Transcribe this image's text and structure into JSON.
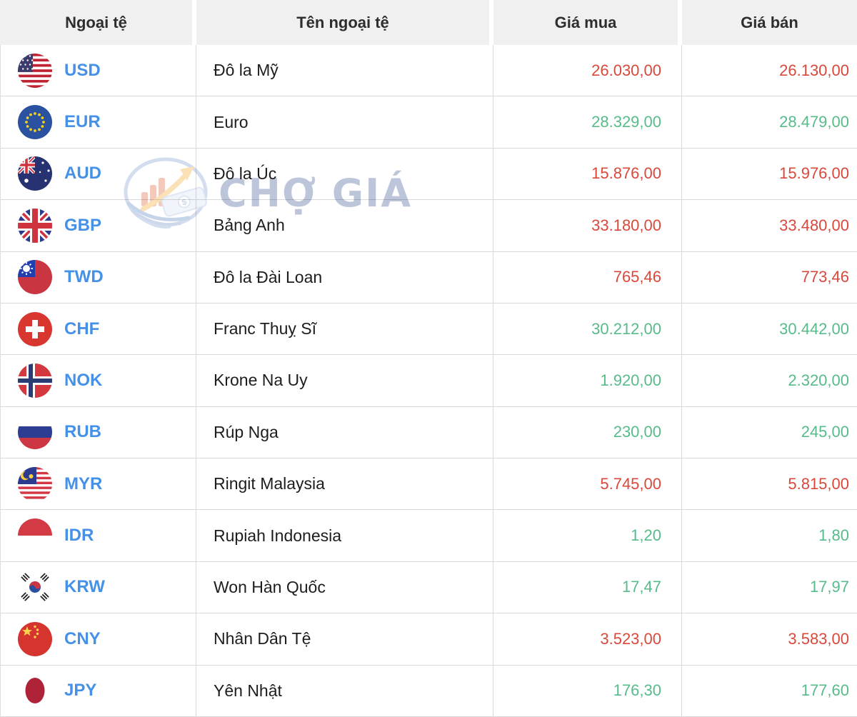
{
  "table": {
    "columns": [
      {
        "key": "currency",
        "label": "Ngoại tệ"
      },
      {
        "key": "name",
        "label": "Tên ngoại tệ"
      },
      {
        "key": "buy",
        "label": "Giá mua"
      },
      {
        "key": "sell",
        "label": "Giá bán"
      }
    ],
    "rows": [
      {
        "code": "USD",
        "name": "Đô la Mỹ",
        "buy": "26.030,00",
        "sell": "26.130,00",
        "trend": "down"
      },
      {
        "code": "EUR",
        "name": "Euro",
        "buy": "28.329,00",
        "sell": "28.479,00",
        "trend": "up"
      },
      {
        "code": "AUD",
        "name": "Đô la Úc",
        "buy": "15.876,00",
        "sell": "15.976,00",
        "trend": "down"
      },
      {
        "code": "GBP",
        "name": "Bảng Anh",
        "buy": "33.180,00",
        "sell": "33.480,00",
        "trend": "down"
      },
      {
        "code": "TWD",
        "name": "Đô la Đài Loan",
        "buy": "765,46",
        "sell": "773,46",
        "trend": "down"
      },
      {
        "code": "CHF",
        "name": "Franc Thuỵ Sĩ",
        "buy": "30.212,00",
        "sell": "30.442,00",
        "trend": "up"
      },
      {
        "code": "NOK",
        "name": "Krone Na Uy",
        "buy": "1.920,00",
        "sell": "2.320,00",
        "trend": "up"
      },
      {
        "code": "RUB",
        "name": "Rúp Nga",
        "buy": "230,00",
        "sell": "245,00",
        "trend": "up"
      },
      {
        "code": "MYR",
        "name": "Ringit Malaysia",
        "buy": "5.745,00",
        "sell": "5.815,00",
        "trend": "down"
      },
      {
        "code": "IDR",
        "name": "Rupiah Indonesia",
        "buy": "1,20",
        "sell": "1,80",
        "trend": "up"
      },
      {
        "code": "KRW",
        "name": "Won Hàn Quốc",
        "buy": "17,47",
        "sell": "17,97",
        "trend": "up"
      },
      {
        "code": "CNY",
        "name": "Nhân Dân Tệ",
        "buy": "3.523,00",
        "sell": "3.583,00",
        "trend": "down"
      },
      {
        "code": "JPY",
        "name": "Yên Nhật",
        "buy": "176,30",
        "sell": "177,60",
        "trend": "up"
      }
    ]
  },
  "watermark": {
    "text": "CHỢ GIÁ"
  },
  "colors": {
    "price_up": "#57bb8a",
    "price_down": "#d9483b",
    "currency_code": "#4691e8",
    "header_bg": "#f0f0f0",
    "row_border": "#d9d9d9",
    "watermark_text": "#b7c0d6"
  }
}
